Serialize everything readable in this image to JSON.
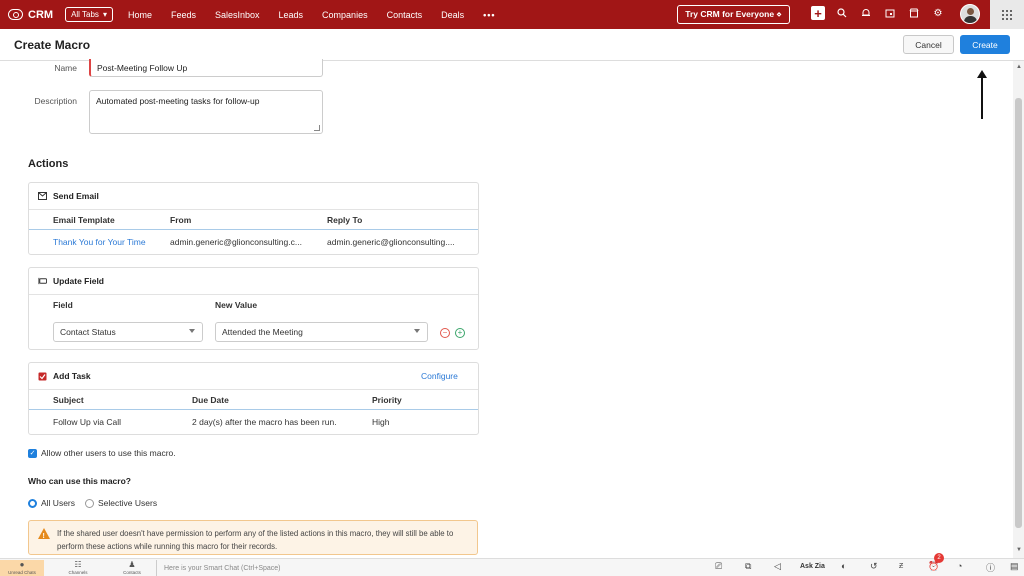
{
  "topbar": {
    "brand": "CRM",
    "all_tabs": "All Tabs",
    "all_tabs_caret": "▾",
    "nav": [
      "Home",
      "Feeds",
      "SalesInbox",
      "Leads",
      "Companies",
      "Contacts",
      "Deals"
    ],
    "more": "•••",
    "try_crm": "Try CRM for Everyone ⋄"
  },
  "header": {
    "title": "Create Macro",
    "cancel": "Cancel",
    "create": "Create"
  },
  "form": {
    "name_label": "Name",
    "name_value": "Post-Meeting Follow Up",
    "desc_label": "Description",
    "desc_value": "Automated post-meeting tasks for follow-up"
  },
  "actions": {
    "title": "Actions",
    "send_email": {
      "title": "Send Email",
      "columns": [
        "Email Template",
        "From",
        "Reply To"
      ],
      "row": [
        "Thank You for Your Time",
        "admin.generic@glionconsulting.c...",
        "admin.generic@glionconsulting...."
      ]
    },
    "update_field": {
      "title": "Update Field",
      "columns": [
        "Field",
        "New Value"
      ],
      "field_value": "Contact Status",
      "new_value": "Attended the Meeting"
    },
    "add_task": {
      "title": "Add Task",
      "configure": "Configure",
      "columns": [
        "Subject",
        "Due Date",
        "Priority"
      ],
      "row": [
        "Follow Up via Call",
        "2 day(s) after the macro has been run.",
        "High"
      ]
    }
  },
  "sharing": {
    "allow_label": "Allow other users to use this macro.",
    "who_label": "Who can use this macro?",
    "all_users": "All Users",
    "selective_users": "Selective Users",
    "warning": "If the shared user doesn't have permission to perform any of the listed actions in this macro, they will still be able to perform these actions while running this macro for their records."
  },
  "bottombar": {
    "unread": "Unread Chats",
    "channels": "Channels",
    "contacts": "Contacts",
    "smart_chat": "Here is your Smart Chat (Ctrl+Space)",
    "ask_zia": "Ask Zia",
    "badge_count": "2"
  },
  "colors": {
    "topbar": "#a11616",
    "primary": "#1f80dd",
    "link": "#2c7ad6",
    "warning_bg": "#fdf3e6"
  }
}
